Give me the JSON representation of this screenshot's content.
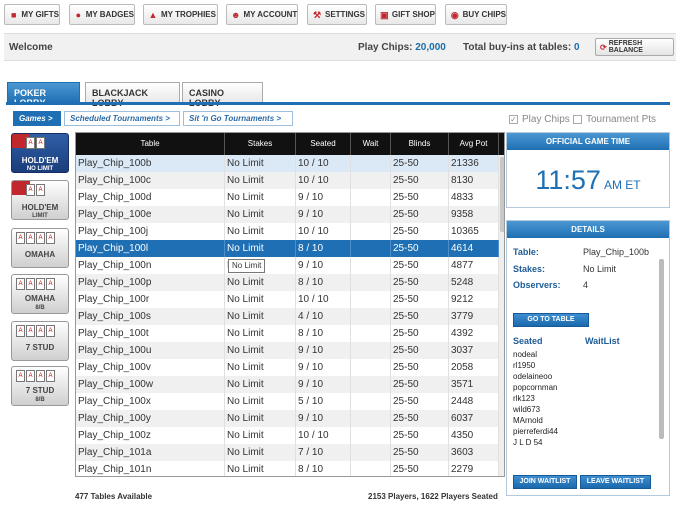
{
  "nav": {
    "items": [
      {
        "label": "MY GIFTS",
        "icon": "gift-icon"
      },
      {
        "label": "MY BADGES",
        "icon": "badge-icon"
      },
      {
        "label": "MY TROPHIES",
        "icon": "trophy-icon"
      },
      {
        "label": "MY ACCOUNT",
        "icon": "account-icon"
      },
      {
        "label": "SETTINGS",
        "icon": "wrench-icon"
      },
      {
        "label": "GIFT SHOP",
        "icon": "cart-icon"
      },
      {
        "label": "BUY CHIPS",
        "icon": "chips-icon"
      }
    ]
  },
  "welcome": {
    "label": "Welcome",
    "play_chips_label": "Play Chips:",
    "play_chips_value": "20,000",
    "buyins_label": "Total buy-ins at tables:",
    "buyins_value": "0",
    "refresh_label": "REFRESH BALANCE"
  },
  "lobby_tabs": [
    "POKER LOBBY",
    "BLACKJACK LOBBY",
    "CASINO LOBBY"
  ],
  "sub_tabs": [
    "Games >",
    "Scheduled Tournaments >",
    "Sit 'n Go Tournaments >"
  ],
  "filters": {
    "play_chips": "Play Chips",
    "tournament_pts": "Tournament Pts"
  },
  "games": [
    {
      "line1": "HOLD'EM",
      "line2": "NO LIMIT"
    },
    {
      "line1": "HOLD'EM",
      "line2": "LIMIT"
    },
    {
      "line1": "OMAHA",
      "line2": ""
    },
    {
      "line1": "OMAHA",
      "line2": "8/B"
    },
    {
      "line1": "7 STUD",
      "line2": ""
    },
    {
      "line1": "7 STUD",
      "line2": "8/B"
    }
  ],
  "table": {
    "headers": [
      "Table",
      "Stakes",
      "Seated",
      "Wait",
      "Blinds",
      "Avg Pot"
    ],
    "rows": [
      [
        "Play_Chip_100b",
        "No Limit",
        "10 / 10",
        "",
        "25-50",
        "21336"
      ],
      [
        "Play_Chip_100c",
        "No Limit",
        "10 / 10",
        "",
        "25-50",
        "8130"
      ],
      [
        "Play_Chip_100d",
        "No Limit",
        "9 / 10",
        "",
        "25-50",
        "4833"
      ],
      [
        "Play_Chip_100e",
        "No Limit",
        "9 / 10",
        "",
        "25-50",
        "9358"
      ],
      [
        "Play_Chip_100j",
        "No Limit",
        "10 / 10",
        "",
        "25-50",
        "10365"
      ],
      [
        "Play_Chip_100l",
        "No Limit",
        "8 / 10",
        "",
        "25-50",
        "4614"
      ],
      [
        "Play_Chip_100n",
        "No Limit",
        "9 / 10",
        "",
        "25-50",
        "4877"
      ],
      [
        "Play_Chip_100p",
        "No Limit",
        "8 / 10",
        "",
        "25-50",
        "5248"
      ],
      [
        "Play_Chip_100r",
        "No Limit",
        "10 / 10",
        "",
        "25-50",
        "9212"
      ],
      [
        "Play_Chip_100s",
        "No Limit",
        "4 / 10",
        "",
        "25-50",
        "3779"
      ],
      [
        "Play_Chip_100t",
        "No Limit",
        "8 / 10",
        "",
        "25-50",
        "4392"
      ],
      [
        "Play_Chip_100u",
        "No Limit",
        "9 / 10",
        "",
        "25-50",
        "3037"
      ],
      [
        "Play_Chip_100v",
        "No Limit",
        "9 / 10",
        "",
        "25-50",
        "2058"
      ],
      [
        "Play_Chip_100w",
        "No Limit",
        "9 / 10",
        "",
        "25-50",
        "3571"
      ],
      [
        "Play_Chip_100x",
        "No Limit",
        "5 / 10",
        "",
        "25-50",
        "2448"
      ],
      [
        "Play_Chip_100y",
        "No Limit",
        "9 / 10",
        "",
        "25-50",
        "6037"
      ],
      [
        "Play_Chip_100z",
        "No Limit",
        "10 / 10",
        "",
        "25-50",
        "4350"
      ],
      [
        "Play_Chip_101a",
        "No Limit",
        "7 / 10",
        "",
        "25-50",
        "3603"
      ],
      [
        "Play_Chip_101n",
        "No Limit",
        "8 / 10",
        "",
        "25-50",
        "2279"
      ]
    ],
    "highlighted_row": 0,
    "selected_row": 5,
    "tooltip": "No Limit"
  },
  "footer": {
    "tables_available": "477 Tables Available",
    "players": "2153 Players, 1622 Players Seated"
  },
  "game_time": {
    "title": "OFFICIAL GAME TIME",
    "time": "11:57",
    "zone": "AM ET"
  },
  "details": {
    "title": "DETAILS",
    "table_label": "Table:",
    "table_value": "Play_Chip_100b",
    "stakes_label": "Stakes:",
    "stakes_value": "No Limit",
    "observers_label": "Observers:",
    "observers_value": "4",
    "go_button": "GO TO TABLE",
    "seated_label": "Seated",
    "waitlist_label": "WaitList",
    "seated": [
      "nodeal",
      "rl1950",
      "odelaineoo",
      "popcornman",
      "rlk123",
      "wild673",
      "MArnold",
      "pierreferdi44",
      "J L D 54"
    ],
    "join_button": "JOIN WAITLIST",
    "leave_button": "LEAVE WAITLIST"
  }
}
